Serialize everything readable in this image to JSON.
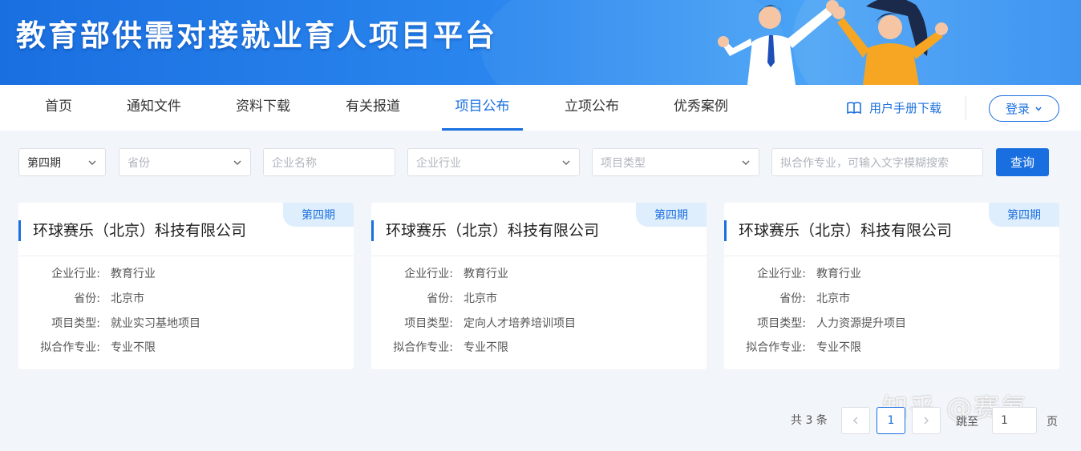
{
  "banner": {
    "title": "教育部供需对接就业育人项目平台"
  },
  "nav": {
    "items": [
      {
        "label": "首页"
      },
      {
        "label": "通知文件"
      },
      {
        "label": "资料下载"
      },
      {
        "label": "有关报道"
      },
      {
        "label": "项目公布"
      },
      {
        "label": "立项公布"
      },
      {
        "label": "优秀案例"
      }
    ],
    "active_index": 4,
    "manual_label": "用户手册下载",
    "login_label": "登录"
  },
  "filters": {
    "period": {
      "value": "第四期"
    },
    "province": {
      "placeholder": "省份"
    },
    "company": {
      "placeholder": "企业名称"
    },
    "industry": {
      "placeholder": "企业行业"
    },
    "project_type": {
      "placeholder": "项目类型"
    },
    "major": {
      "placeholder": "拟合作专业，可输入文字模糊搜索"
    },
    "query_label": "查询"
  },
  "cards": [
    {
      "badge": "第四期",
      "company": "环球赛乐（北京）科技有限公司",
      "fields": [
        {
          "label": "企业行业:",
          "value": "教育行业"
        },
        {
          "label": "省份:",
          "value": "北京市"
        },
        {
          "label": "项目类型:",
          "value": "就业实习基地项目"
        },
        {
          "label": "拟合作专业:",
          "value": "专业不限"
        }
      ]
    },
    {
      "badge": "第四期",
      "company": "环球赛乐（北京）科技有限公司",
      "fields": [
        {
          "label": "企业行业:",
          "value": "教育行业"
        },
        {
          "label": "省份:",
          "value": "北京市"
        },
        {
          "label": "项目类型:",
          "value": "定向人才培养培训项目"
        },
        {
          "label": "拟合作专业:",
          "value": "专业不限"
        }
      ]
    },
    {
      "badge": "第四期",
      "company": "环球赛乐（北京）科技有限公司",
      "fields": [
        {
          "label": "企业行业:",
          "value": "教育行业"
        },
        {
          "label": "省份:",
          "value": "北京市"
        },
        {
          "label": "项目类型:",
          "value": "人力资源提升项目"
        },
        {
          "label": "拟合作专业:",
          "value": "专业不限"
        }
      ]
    }
  ],
  "pagination": {
    "total_text": "共 3 条",
    "current_page": "1",
    "jump_label": "跳至",
    "jump_value": "1",
    "page_unit": "页"
  },
  "watermark": "知乎 @赛氪",
  "colors": {
    "primary": "#1a6fe0",
    "badge_bg": "#dfeefc",
    "page_bg": "#f2f5f9"
  },
  "icons": {
    "manual": "book-icon",
    "dropdown": "chevron-down-icon",
    "prev": "chevron-left-icon",
    "next": "chevron-right-icon"
  }
}
